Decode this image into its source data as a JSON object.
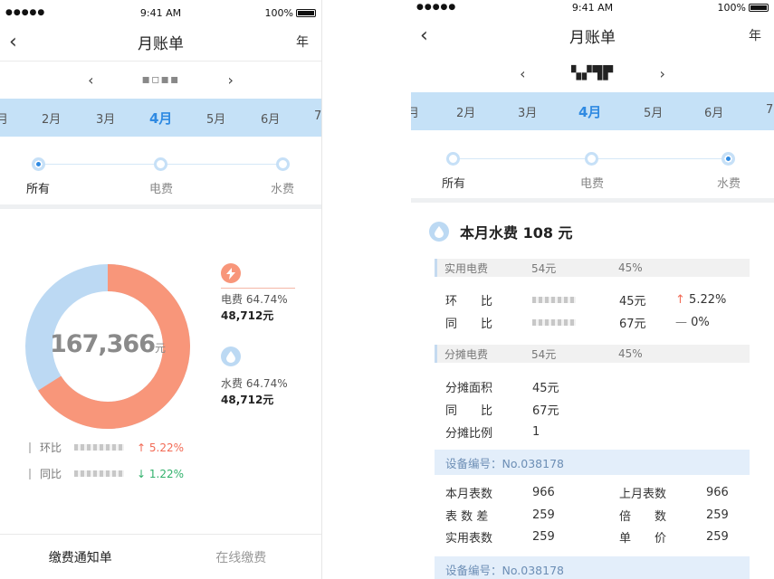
{
  "status": {
    "signal": "●●●●●",
    "wifi": "wifi-icon",
    "time": "9:41 AM",
    "battery": "100%"
  },
  "nav": {
    "title": "月账单",
    "right": "年"
  },
  "colors": {
    "accent": "#2f8ae2",
    "strip": "#c5e1f7",
    "electric": "#f8967a",
    "water": "#bcd9f3",
    "up": "#f26a55",
    "down": "#32b16c"
  },
  "screen1": {
    "months": [
      "月",
      "2月",
      "3月",
      "4月",
      "5月",
      "6月",
      "7"
    ],
    "active_month": "4月",
    "tabs": [
      "所有",
      "电费",
      "水费"
    ],
    "total": "167,366",
    "total_unit": "元",
    "legend": [
      {
        "name": "电费",
        "pct": "64.74%",
        "amount": "48,712元",
        "icon": "lightning-icon"
      },
      {
        "name": "水费",
        "pct": "64.74%",
        "amount": "48,712元",
        "icon": "water-drop-icon"
      }
    ],
    "donut": {
      "electric_fraction": 0.66,
      "water_fraction": 0.34
    },
    "compare": [
      {
        "label": "环比",
        "arrow": "↑",
        "value": "5.22%"
      },
      {
        "label": "同比",
        "arrow": "↓",
        "value": "1.22%"
      }
    ],
    "footer": [
      "缴费通知单",
      "在线缴费"
    ]
  },
  "screen2": {
    "months": [
      "月",
      "2月",
      "3月",
      "4月",
      "5月",
      "6月",
      "7"
    ],
    "active_month": "4月",
    "tabs": [
      "所有",
      "电费",
      "水费"
    ],
    "heading": "本月水费 108 元",
    "sec1": {
      "label": "实用电费",
      "amount": "54元",
      "pct": "45%"
    },
    "rows1": [
      {
        "label": "环　　比",
        "value": "45元",
        "arrow": "↑",
        "change": "5.22%"
      },
      {
        "label": "同　　比",
        "value": "67元",
        "arrow": "—",
        "change": "0%"
      }
    ],
    "sec2": {
      "label": "分摊电费",
      "amount": "54元",
      "pct": "45%"
    },
    "rows2": [
      {
        "label": "分摊面积",
        "value": "45元"
      },
      {
        "label": "同　　比",
        "value": "67元"
      },
      {
        "label": "分摊比例",
        "value": "1"
      }
    ],
    "device1": "设备编号：No.038178",
    "meter": [
      {
        "l1": "本月表数",
        "v1": "966",
        "l2": "上月表数",
        "v2": "966"
      },
      {
        "l1": "表 数 差",
        "v1": "259",
        "l2": "倍　　数",
        "v2": "259"
      },
      {
        "l1": "实用表数",
        "v1": "259",
        "l2": "单　　价",
        "v2": "259"
      }
    ],
    "device2": "设备编号：No.038178"
  }
}
